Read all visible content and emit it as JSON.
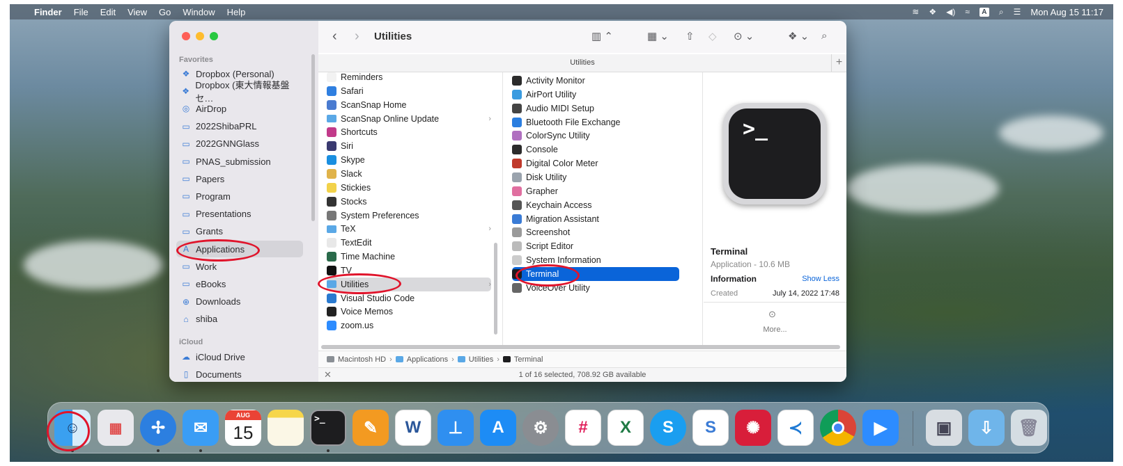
{
  "menubar": {
    "apple_icon": "",
    "app_name": "Finder",
    "menus": [
      "File",
      "Edit",
      "View",
      "Go",
      "Window",
      "Help"
    ],
    "status_icons": [
      "sync-icon",
      "dropbox-icon",
      "volume-icon",
      "wifi-off-icon",
      "input-source-icon",
      "search-icon",
      "control-center-icon"
    ],
    "input_source": "A",
    "clock": "Mon Aug 15  11:17"
  },
  "window": {
    "title": "Utilities",
    "path_tab_title": "Utilities",
    "sidebar": {
      "favorites_header": "Favorites",
      "favorites": [
        {
          "label": "Dropbox (Personal)",
          "icon": "dropbox-icon"
        },
        {
          "label": "Dropbox (東大情報基盤セ…",
          "icon": "dropbox-icon"
        },
        {
          "label": "AirDrop",
          "icon": "airdrop-icon"
        },
        {
          "label": "2022ShibaPRL",
          "icon": "folder-icon"
        },
        {
          "label": "2022GNNGlass",
          "icon": "folder-icon"
        },
        {
          "label": "PNAS_submission",
          "icon": "folder-icon"
        },
        {
          "label": "Papers",
          "icon": "folder-icon"
        },
        {
          "label": "Program",
          "icon": "folder-icon"
        },
        {
          "label": "Presentations",
          "icon": "folder-icon"
        },
        {
          "label": "Grants",
          "icon": "folder-icon"
        },
        {
          "label": "Applications",
          "icon": "applications-icon",
          "selected": true
        },
        {
          "label": "Work",
          "icon": "folder-icon"
        },
        {
          "label": "eBooks",
          "icon": "folder-icon"
        },
        {
          "label": "Downloads",
          "icon": "downloads-icon"
        },
        {
          "label": "shiba",
          "icon": "home-icon"
        }
      ],
      "icloud_header": "iCloud",
      "icloud": [
        {
          "label": "iCloud Drive",
          "icon": "cloud-icon"
        },
        {
          "label": "Documents",
          "icon": "document-icon"
        }
      ]
    },
    "applications_column": [
      {
        "label": "Reminders",
        "color": "#f2f2f2"
      },
      {
        "label": "Safari",
        "color": "#2f7fe0"
      },
      {
        "label": "ScanSnap Home",
        "color": "#4a7bd0"
      },
      {
        "label": "ScanSnap Online Update",
        "color": "#5aa8e6",
        "folder": true
      },
      {
        "label": "Shortcuts",
        "color": "#c23a8a"
      },
      {
        "label": "Siri",
        "color": "#3a3a70"
      },
      {
        "label": "Skype",
        "color": "#1a8fe0"
      },
      {
        "label": "Slack",
        "color": "#e0b34a"
      },
      {
        "label": "Stickies",
        "color": "#f2d24a"
      },
      {
        "label": "Stocks",
        "color": "#333333"
      },
      {
        "label": "System Preferences",
        "color": "#777777"
      },
      {
        "label": "TeX",
        "color": "#5aa8e6",
        "folder": true
      },
      {
        "label": "TextEdit",
        "color": "#e8e8e8"
      },
      {
        "label": "Time Machine",
        "color": "#2a6a4a"
      },
      {
        "label": "TV",
        "color": "#111111"
      },
      {
        "label": "Utilities",
        "color": "#5aa8e6",
        "folder": true,
        "highlighted": true
      },
      {
        "label": "Visual Studio Code",
        "color": "#2a7ad0"
      },
      {
        "label": "Voice Memos",
        "color": "#222222"
      },
      {
        "label": "zoom.us",
        "color": "#2d8cff"
      }
    ],
    "utilities_column": [
      {
        "label": "Activity Monitor",
        "color": "#2b2b2b"
      },
      {
        "label": "AirPort Utility",
        "color": "#3a9be0"
      },
      {
        "label": "Audio MIDI Setup",
        "color": "#444444"
      },
      {
        "label": "Bluetooth File Exchange",
        "color": "#2a7ee0"
      },
      {
        "label": "ColorSync Utility",
        "color": "#b070c0"
      },
      {
        "label": "Console",
        "color": "#2b2b2b"
      },
      {
        "label": "Digital Color Meter",
        "color": "#c0392b"
      },
      {
        "label": "Disk Utility",
        "color": "#9aa3ad"
      },
      {
        "label": "Grapher",
        "color": "#e06fa0"
      },
      {
        "label": "Keychain Access",
        "color": "#555555"
      },
      {
        "label": "Migration Assistant",
        "color": "#3a7bd5"
      },
      {
        "label": "Screenshot",
        "color": "#9a9a9a"
      },
      {
        "label": "Script Editor",
        "color": "#bbbbbb"
      },
      {
        "label": "System Information",
        "color": "#cccccc"
      },
      {
        "label": "Terminal",
        "color": "#1d1d1f",
        "selected": true
      },
      {
        "label": "VoiceOver Utility",
        "color": "#666666"
      }
    ],
    "preview": {
      "icon_prompt": ">_",
      "name": "Terminal",
      "kind": "Application - 10.6 MB",
      "info_header": "Information",
      "show_less": "Show Less",
      "created_label": "Created",
      "created_value": "July 14, 2022 17:48",
      "more_label": "More..."
    },
    "pathbar": [
      "Macintosh HD",
      "Applications",
      "Utilities",
      "Terminal"
    ],
    "status": "1 of 16 selected, 708.92 GB available"
  },
  "dock": {
    "calendar_month": "AUG",
    "calendar_day": "15",
    "apps": [
      "finder-icon",
      "launchpad-icon",
      "safari-icon",
      "mail-icon",
      "calendar-icon",
      "notes-icon",
      "terminal-icon",
      "pages-icon",
      "word-icon",
      "keynote-icon",
      "app-store-icon",
      "system-preferences-icon",
      "slack-icon",
      "excel-icon",
      "skype-icon",
      "scansnap-icon",
      "mendeley-icon",
      "vscode-icon",
      "chrome-icon",
      "zoom-icon",
      "preview-icon",
      "downloads-stack-icon",
      "trash-icon"
    ]
  },
  "colors": {
    "selection": "#0a64d9",
    "annotation": "#e0142b",
    "sidebar_bg": "#e9e7ec"
  }
}
